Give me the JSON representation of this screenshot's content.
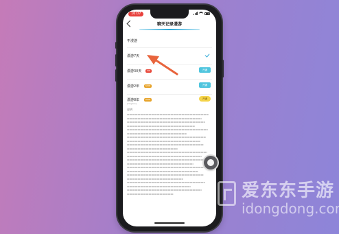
{
  "status": {
    "time": "16:07"
  },
  "nav": {
    "title": "聊天记录漫游"
  },
  "options": [
    {
      "label": "不漫游"
    },
    {
      "label": "漫游7天"
    },
    {
      "label": "漫游30天",
      "badge": "VIP",
      "button": "开通"
    },
    {
      "label": "漫游2年",
      "badge": "SVIP",
      "button": "开通"
    },
    {
      "label": "漫游8年",
      "badge": "SVIP",
      "button": "开通",
      "sub": "[illegible]"
    }
  ],
  "description": {
    "title": "说明"
  },
  "watermark": {
    "brand": "爱东东手游",
    "url": "idongdong.com"
  },
  "colors": {
    "accent": "#2aa7d6",
    "arrow": "#e8643c"
  }
}
